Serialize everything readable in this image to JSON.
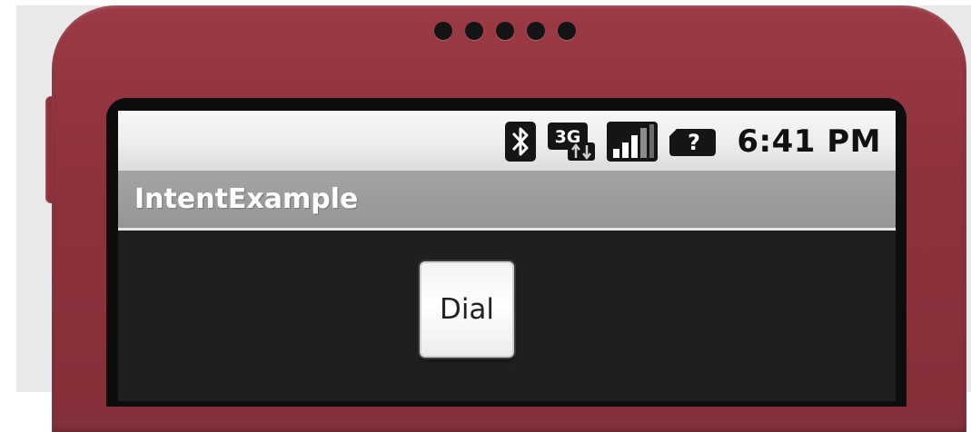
{
  "app": {
    "title": "IntentExample"
  },
  "status_bar": {
    "time": "6:41 PM",
    "icons": [
      "bluetooth-icon",
      "3g-data-icon",
      "signal-strength-icon",
      "no-sim-icon"
    ],
    "network_label": "3G",
    "sim_label": "?"
  },
  "main": {
    "dial_button_label": "Dial"
  },
  "colors": {
    "phone_body": "#8e323d",
    "title_bar": "#9a9a9a",
    "screen_background": "#1f1f1f",
    "status_bar": "#efefef"
  }
}
